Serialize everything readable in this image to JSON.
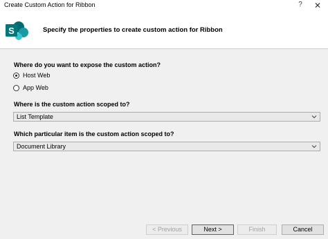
{
  "window": {
    "title": "Create Custom Action for Ribbon",
    "help_label": "?",
    "close_label": "✕"
  },
  "header": {
    "logo_icon": "sharepoint-icon",
    "text": "Specify the properties to create custom action for Ribbon"
  },
  "expose": {
    "question": "Where do you want to expose the custom action?",
    "options": [
      {
        "label": "Host Web",
        "checked": true
      },
      {
        "label": "App Web",
        "checked": false
      }
    ]
  },
  "scope": {
    "question": "Where is the custom action scoped to?",
    "value": "List Template"
  },
  "item": {
    "question": "Which particular item is the custom action scoped to?",
    "value": "Document Library"
  },
  "buttons": {
    "previous": "< Previous",
    "next": "Next >",
    "finish": "Finish",
    "cancel": "Cancel"
  },
  "colors": {
    "accent": "#0078d7",
    "sharepoint": "#0a7ab8",
    "panel": "#f0f0f0"
  }
}
